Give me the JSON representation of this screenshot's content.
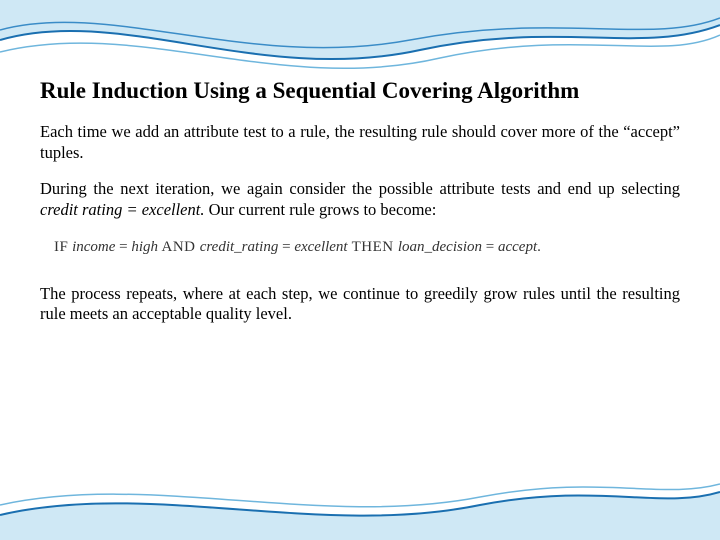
{
  "title": "Rule Induction Using a Sequential Covering Algorithm",
  "para1": "Each time we add an attribute test to a rule, the resulting rule should cover more of the “accept” tuples.",
  "para2_a": "During the next iteration, we again consider the possible attribute tests and end up selecting ",
  "para2_em": "credit rating = excellent.",
  "para2_b": " Our current rule grows to become:",
  "rule": {
    "if": "IF",
    "c1a": "income",
    "eq1": " = ",
    "c1b": "high",
    "and": " AND ",
    "c2a": "credit_rating",
    "eq2": " = ",
    "c2b": "excellent",
    "then": " THEN ",
    "c3a": "loan_decision",
    "eq3": " = ",
    "c3b": "accept",
    "dot": "."
  },
  "para3": "The process repeats, where at each step, we continue to greedily grow rules until the resulting rule meets an acceptable quality level."
}
